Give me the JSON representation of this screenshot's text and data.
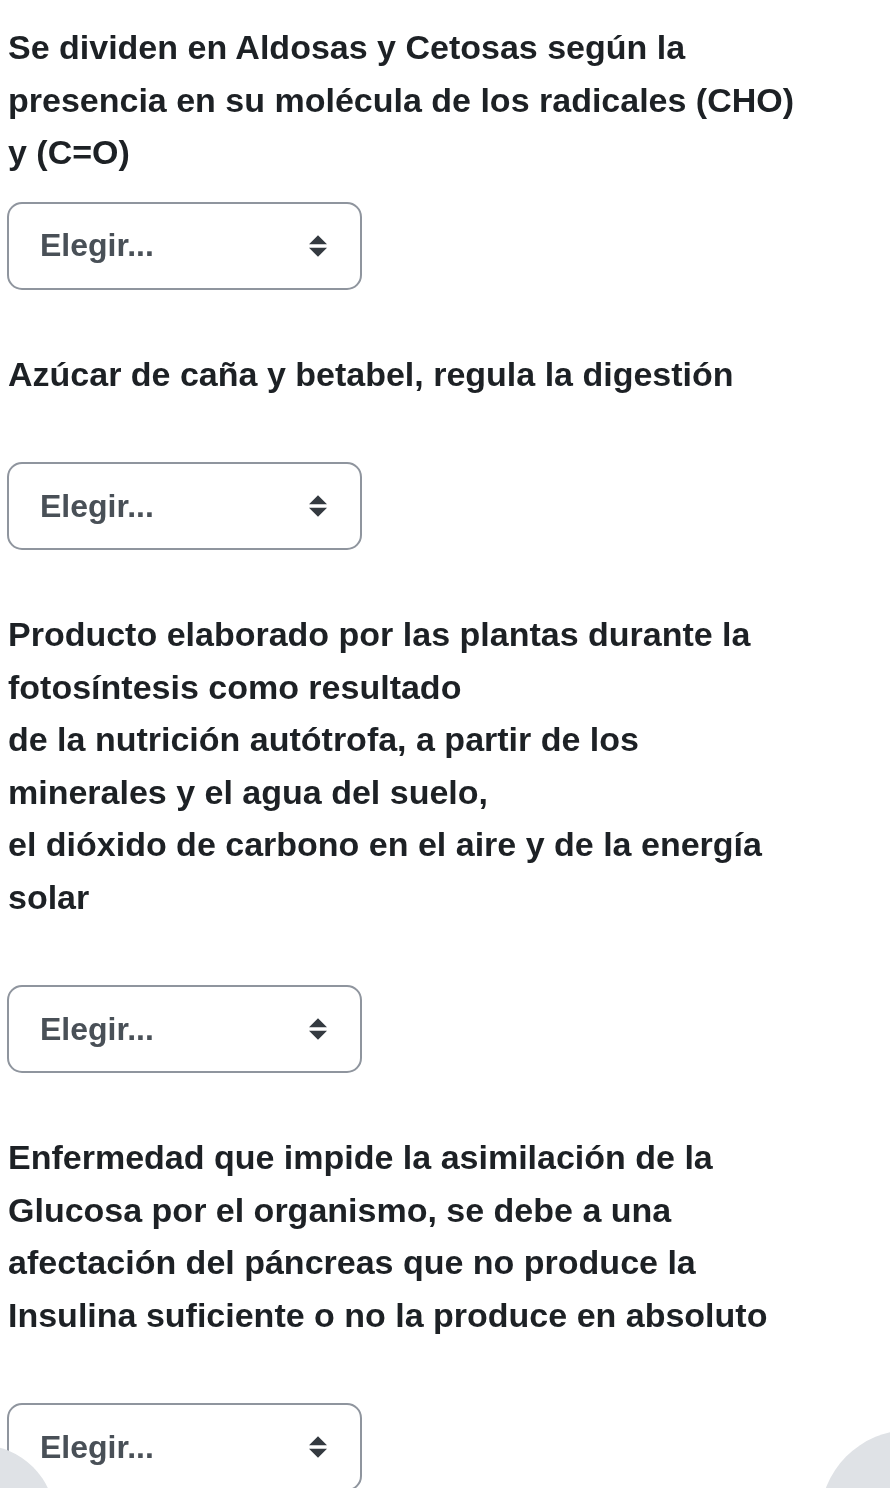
{
  "questions": [
    {
      "text": "Se dividen en Aldosas y Cetosas según la\npresencia en su molécula de los radicales (CHO)\ny (C=O)",
      "select": {
        "value": "Elegir..."
      }
    },
    {
      "text": "Azúcar de caña y betabel, regula la digestión",
      "select": {
        "value": "Elegir..."
      }
    },
    {
      "text": "Producto elaborado por las plantas durante la\nfotosíntesis como resultado\nde la nutrición autótrofa, a partir de los\nminerales y el agua del suelo,\nel dióxido de carbono en el aire y de la energía\nsolar",
      "select": {
        "value": "Elegir..."
      }
    },
    {
      "text": "Enfermedad que impide la asimilación de la\nGlucosa por el organismo, se debe a una\nafectación del páncreas que no produce la\nInsulina suficiente o no la produce en absoluto",
      "select": {
        "value": "Elegir..."
      }
    }
  ]
}
